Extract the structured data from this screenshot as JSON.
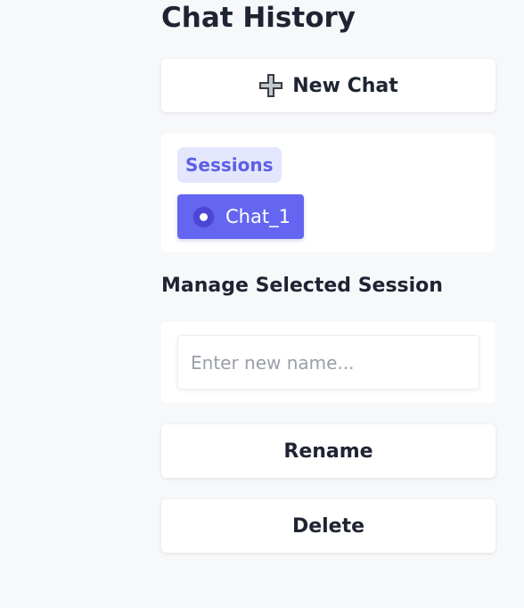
{
  "sidebar": {
    "title": "Chat History",
    "new_chat_label": "New Chat",
    "sessions_label": "Sessions",
    "sessions": [
      {
        "label": "Chat_1",
        "selected": true
      }
    ],
    "manage_heading": "Manage Selected Session",
    "rename_input": {
      "value": "",
      "placeholder": "Enter new name..."
    },
    "rename_label": "Rename",
    "delete_label": "Delete"
  },
  "colors": {
    "accent": "#6466f1",
    "accent_soft": "#e3e6fd",
    "background": "#f7f8fa",
    "text": "#1f2433"
  },
  "icons": {
    "new_chat": "plus-icon",
    "session": "radio-selected-icon"
  }
}
